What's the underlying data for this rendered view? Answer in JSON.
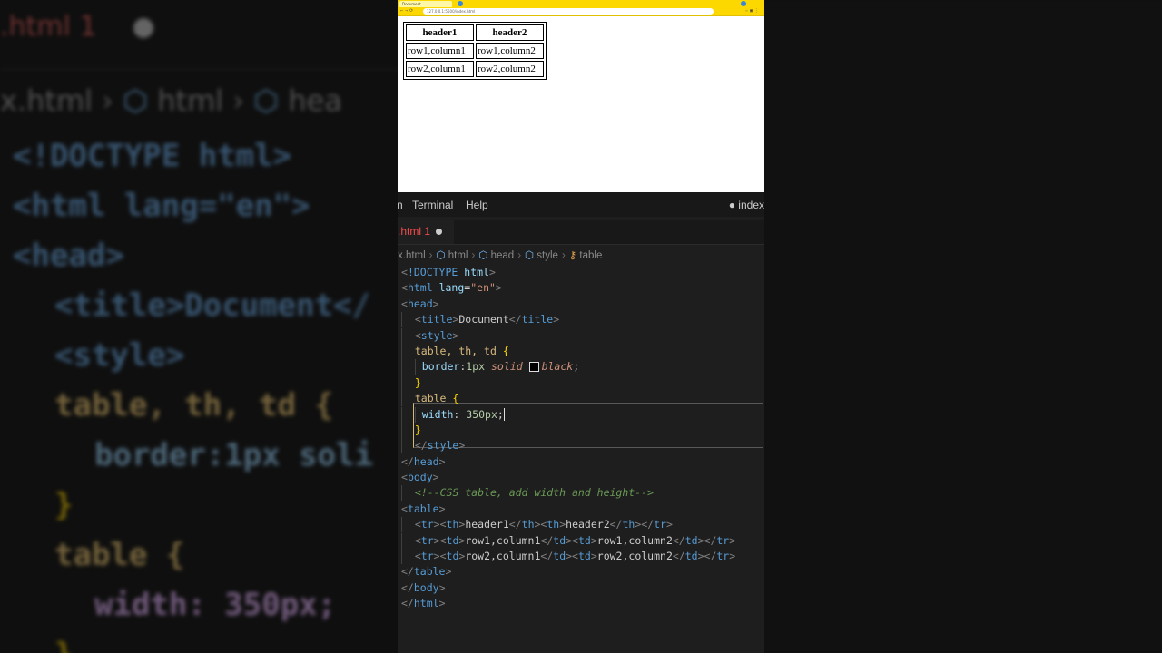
{
  "browser": {
    "tab_title": "Document",
    "url": "127.0.0.1:5500/index.html",
    "table": {
      "headers": [
        "header1",
        "header2"
      ],
      "rows": [
        [
          "row1,column1",
          "row1,column2"
        ],
        [
          "row2,column1",
          "row2,column2"
        ]
      ]
    }
  },
  "editor": {
    "menu": {
      "partial": "n",
      "terminal": "Terminal",
      "help": "Help",
      "file_indicator": "● index"
    },
    "tab": {
      "name": ".html 1"
    },
    "breadcrumb": {
      "file": "x.html",
      "html": "html",
      "head": "head",
      "style": "style",
      "table": "table"
    },
    "accent_colors": {
      "tag": "#569cd6",
      "attr": "#9cdcfe",
      "string": "#ce9178",
      "selector": "#d7ba7d",
      "number": "#b5cea8",
      "comment": "#6a9955",
      "error_tab": "#f14c4c"
    },
    "code": {
      "l1_doctype": "!DOCTYPE",
      "l1_html": "html",
      "l2_tag": "html",
      "l2_attr": "lang",
      "l2_val": "\"en\"",
      "l3_tag": "head",
      "l4_tag": "title",
      "l4_text": "Document",
      "l5_tag": "style",
      "l6_selector": "table, th, td",
      "l7_prop": "border",
      "l7_num": "1px",
      "l7_solid": "solid",
      "l7_color": "black",
      "l9_selector": "table",
      "l10_prop": "width",
      "l10_num": "350px",
      "l12_tag": "style",
      "l13_tag": "head",
      "l14_tag": "body",
      "l15_comment": "<!--CSS table, add width and height-->",
      "l16_tag": "table",
      "tag_tr": "tr",
      "tag_th": "th",
      "tag_td": "td",
      "l17_h1": "header1",
      "l17_h2": "header2",
      "l18_c1": "row1,column1",
      "l18_c2": "row1,column2",
      "l19_c1": "row2,column1",
      "l19_c2": "row2,column2",
      "l20_tag": "table",
      "l21_tag": "body",
      "l22_tag": "html"
    }
  },
  "background_zoom": {
    "tab_name": ".html 1",
    "bread_file": "x.html",
    "bread_html": "html",
    "bread_head": "hea",
    "line1": "<!DOCTYPE html>",
    "line2": "<html lang=\"en\">",
    "line3": "<head>",
    "line4": "<title>Document</",
    "line5": "<style>",
    "line6": "table, th, td {",
    "line7": "border:1px soli",
    "line8": "}",
    "line9": "table {",
    "line10": "width: 350px;",
    "line11": "}"
  }
}
